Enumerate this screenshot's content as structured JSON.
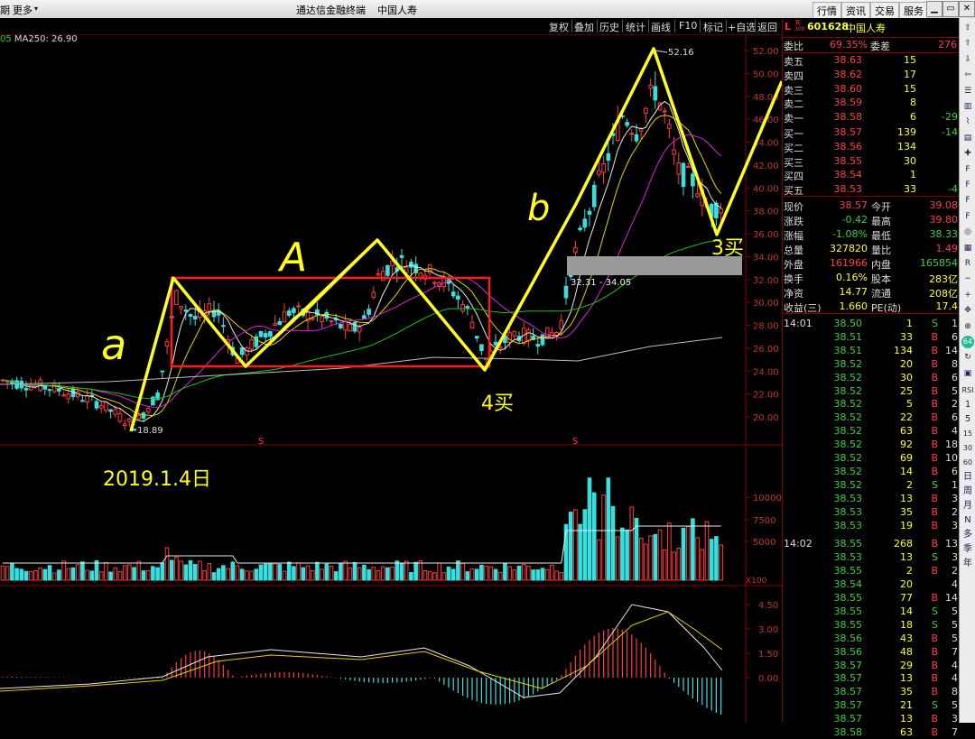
{
  "titlebar": {
    "left_tab_fragment": "期",
    "more_label": "更多",
    "more_arrow": "▾",
    "app_title": "通达信金融终端",
    "stock_title": "中国人寿",
    "menu": [
      "行情",
      "资讯",
      "交易",
      "服务"
    ],
    "window_buttons": [
      "minimize-icon",
      "restore-icon",
      "close-icon"
    ]
  },
  "toolbar": {
    "tools": [
      "复权",
      "叠加",
      "历史",
      "统计",
      "画线",
      "F10",
      "标记",
      "+自选",
      "返回"
    ]
  },
  "ma_line": {
    "prefix": "05",
    "text": "MA250: 26.90"
  },
  "chart": {
    "price_axis": [
      "52.00",
      "50.00",
      "48.00",
      "46.00",
      "44.00",
      "42.00",
      "40.00",
      "38.00",
      "36.00",
      "34.00",
      "32.00",
      "30.00",
      "28.00",
      "26.00",
      "24.00",
      "22.00",
      "20.00"
    ],
    "high_label": "52.16",
    "low_label": "18.89",
    "range_label": "32.31 - 34.05",
    "s_markers": [
      "S",
      "S"
    ],
    "volume_axis": [
      "10000",
      "7500",
      "5000"
    ],
    "volume_unit": "X100",
    "macd_axis": [
      "4.50",
      "3.00",
      "1.50",
      "0.00"
    ],
    "annotations": {
      "a_small": "a",
      "A_big": "A",
      "b_small": "b",
      "buy4": "4买",
      "buy3": "3买",
      "date": "2019.1.4日"
    },
    "colors": {
      "up": "#ff3b3b",
      "down": "#37e0e0",
      "zigzag": "#ffff20",
      "box": "#ff1a1a",
      "ma_white": "#e8e8e8",
      "ma_yellow": "#e6d200",
      "ma_magenta": "#e020e0",
      "ma_green": "#1fbf1f",
      "ma_gray": "#bdbdbd"
    }
  },
  "quote": {
    "code_marker": "L",
    "r_marker": "R",
    "r_sub": "300",
    "code": "601628",
    "name": "中国人寿",
    "weibi_label": "委比",
    "weibi": "69.35%",
    "weicha_label": "委差",
    "weicha": "276",
    "asks": [
      {
        "label": "卖五",
        "price": "38.63",
        "vol": "15",
        "chg": ""
      },
      {
        "label": "卖四",
        "price": "38.62",
        "vol": "17",
        "chg": ""
      },
      {
        "label": "卖三",
        "price": "38.60",
        "vol": "15",
        "chg": ""
      },
      {
        "label": "卖二",
        "price": "38.59",
        "vol": "8",
        "chg": ""
      },
      {
        "label": "卖一",
        "price": "38.58",
        "vol": "6",
        "chg": "-29"
      }
    ],
    "bids": [
      {
        "label": "买一",
        "price": "38.57",
        "vol": "139",
        "chg": "-14"
      },
      {
        "label": "买二",
        "price": "38.56",
        "vol": "134",
        "chg": ""
      },
      {
        "label": "买三",
        "price": "38.55",
        "vol": "30",
        "chg": ""
      },
      {
        "label": "买四",
        "price": "38.54",
        "vol": "1",
        "chg": ""
      },
      {
        "label": "买五",
        "price": "38.53",
        "vol": "33",
        "chg": "-4"
      }
    ],
    "stats": [
      {
        "l1": "现价",
        "v1": "38.57",
        "l2": "今开",
        "v2": "39.08"
      },
      {
        "l1": "涨跌",
        "v1": "-0.42",
        "l2": "最高",
        "v2": "39.80"
      },
      {
        "l1": "涨幅",
        "v1": "-1.08%",
        "l2": "最低",
        "v2": "38.33"
      },
      {
        "l1": "总量",
        "v1": "327820",
        "l2": "量比",
        "v2": "1.49"
      },
      {
        "l1": "外盘",
        "v1": "161966",
        "l2": "内盘",
        "v2": "165854"
      },
      {
        "l1": "换手",
        "v1": "0.16%",
        "l2": "股本",
        "v2": "283亿"
      },
      {
        "l1": "净资",
        "v1": "14.77",
        "l2": "流通",
        "v2": "208亿"
      },
      {
        "l1": "收益(三)",
        "v1": "1.660",
        "l2": "PE(动)",
        "v2": "17.4"
      }
    ],
    "ticks1_time": "14:01",
    "ticks1": [
      {
        "p": "38.50",
        "v": "1",
        "t": "S",
        "n": "1"
      },
      {
        "p": "38.51",
        "v": "33",
        "t": "B",
        "n": "6"
      },
      {
        "p": "38.51",
        "v": "134",
        "t": "B",
        "n": "14"
      },
      {
        "p": "38.52",
        "v": "20",
        "t": "B",
        "n": "8"
      },
      {
        "p": "38.52",
        "v": "30",
        "t": "B",
        "n": "6"
      },
      {
        "p": "38.52",
        "v": "25",
        "t": "B",
        "n": "5"
      },
      {
        "p": "38.52",
        "v": "5",
        "t": "B",
        "n": "2"
      },
      {
        "p": "38.52",
        "v": "22",
        "t": "B",
        "n": "6"
      },
      {
        "p": "38.52",
        "v": "63",
        "t": "B",
        "n": "4"
      },
      {
        "p": "38.52",
        "v": "92",
        "t": "B",
        "n": "18"
      },
      {
        "p": "38.52",
        "v": "69",
        "t": "B",
        "n": "10"
      },
      {
        "p": "38.52",
        "v": "14",
        "t": "B",
        "n": "6"
      },
      {
        "p": "38.52",
        "v": "2",
        "t": "S",
        "n": "1"
      },
      {
        "p": "38.53",
        "v": "13",
        "t": "B",
        "n": "3"
      },
      {
        "p": "38.53",
        "v": "35",
        "t": "B",
        "n": "2"
      },
      {
        "p": "38.53",
        "v": "19",
        "t": "B",
        "n": "3"
      }
    ],
    "ticks2_time": "14:02",
    "ticks2_first": {
      "p": "38.55",
      "v": "268",
      "t": "B",
      "n": "13"
    },
    "ticks2": [
      {
        "p": "38.53",
        "v": "13",
        "t": "S",
        "n": "3"
      },
      {
        "p": "38.55",
        "v": "2",
        "t": "B",
        "n": "2"
      },
      {
        "p": "38.54",
        "v": "20",
        "t": "",
        "n": "4"
      },
      {
        "p": "38.55",
        "v": "77",
        "t": "B",
        "n": "14"
      },
      {
        "p": "38.55",
        "v": "14",
        "t": "S",
        "n": "5"
      },
      {
        "p": "38.55",
        "v": "18",
        "t": "S",
        "n": "5"
      },
      {
        "p": "38.56",
        "v": "43",
        "t": "B",
        "n": "5"
      },
      {
        "p": "38.56",
        "v": "48",
        "t": "B",
        "n": "7"
      },
      {
        "p": "38.57",
        "v": "29",
        "t": "B",
        "n": "4"
      },
      {
        "p": "38.57",
        "v": "13",
        "t": "B",
        "n": "4"
      },
      {
        "p": "38.57",
        "v": "35",
        "t": "B",
        "n": "8"
      },
      {
        "p": "38.57",
        "v": "21",
        "t": "S",
        "n": "5"
      },
      {
        "p": "38.57",
        "v": "13",
        "t": "B",
        "n": "3"
      },
      {
        "p": "38.58",
        "v": "63",
        "t": "B",
        "n": "7"
      }
    ]
  },
  "sidebar": {
    "icons": [
      "up-arrow-icon",
      "up-outline-icon",
      "down-outline-icon",
      "back-icon",
      "list-icon",
      "kline-icon",
      "line-chart-icon",
      "bar-icon",
      "crossline-icon",
      "f10-icon",
      "f1-icon",
      "f2-icon",
      "f3-icon",
      "target-icon",
      "chart-small-icon",
      "rsi-icon",
      "minus-icon",
      "plus-icon",
      "move-icon",
      "zoom-icon",
      "badge-icon",
      "refresh-icon",
      "chart-select-icon"
    ],
    "labels": [
      "RSI",
      "1",
      "5",
      "15",
      "30",
      "60",
      "日",
      "周",
      "月",
      "N",
      "多",
      "季",
      "年"
    ],
    "badge": "64"
  }
}
